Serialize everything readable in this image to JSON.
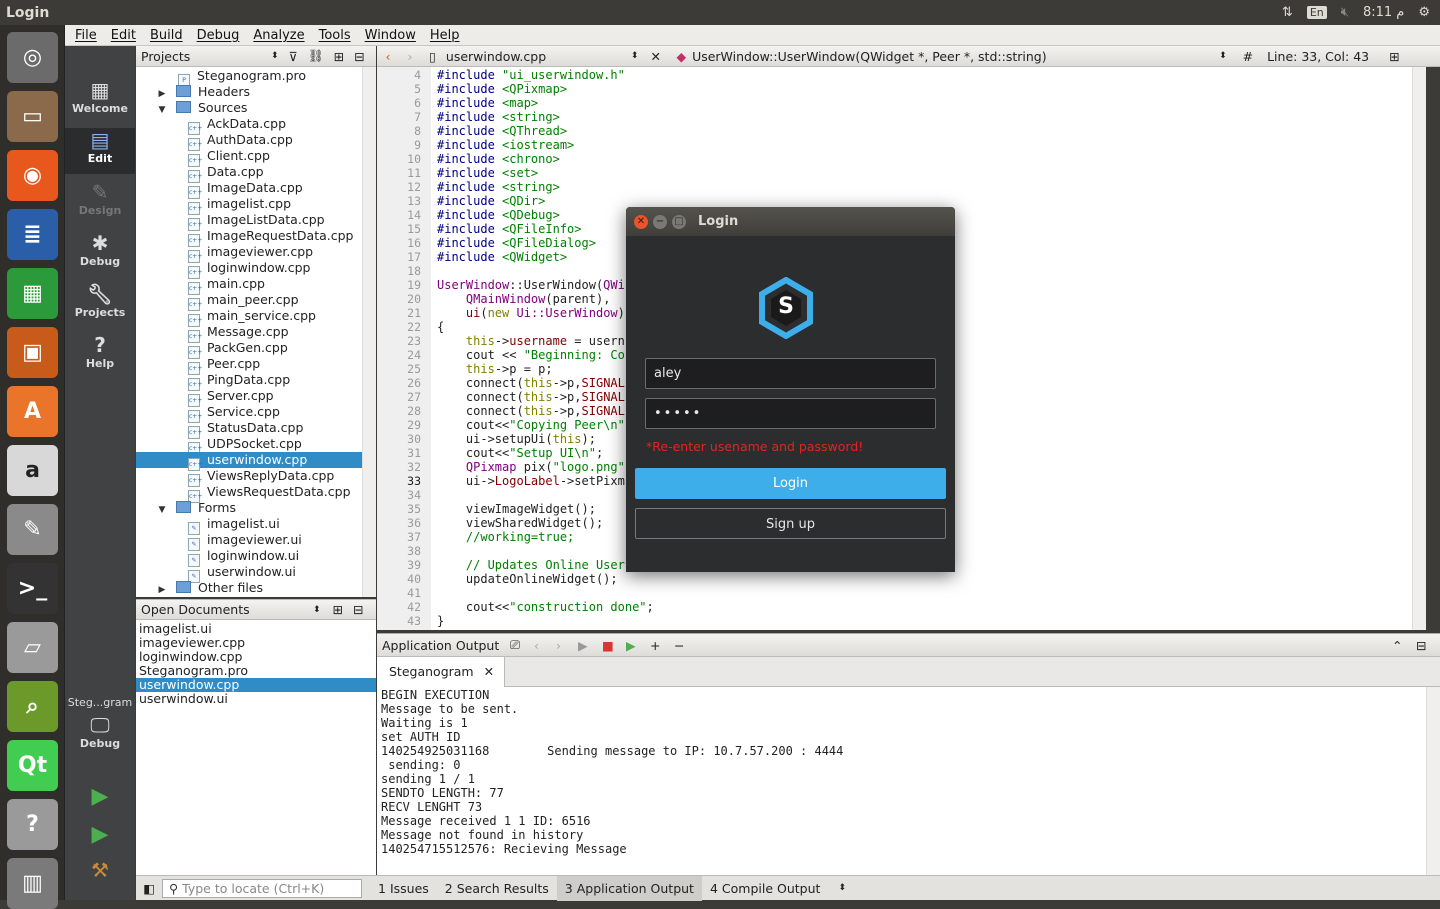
{
  "window_title": "Login",
  "system": {
    "lang": "En",
    "time": "8:11",
    "ampm": "م"
  },
  "menubar": [
    "File",
    "Edit",
    "Build",
    "Debug",
    "Analyze",
    "Tools",
    "Window",
    "Help"
  ],
  "modes": [
    {
      "label": "Welcome",
      "icon": "grid-icon"
    },
    {
      "label": "Edit",
      "icon": "edit-document-icon"
    },
    {
      "label": "Design",
      "icon": "pencil-icon"
    },
    {
      "label": "Debug",
      "icon": "bug-icon"
    },
    {
      "label": "Projects",
      "icon": "wrench-icon"
    },
    {
      "label": "Help",
      "icon": "help-icon"
    }
  ],
  "run_target": {
    "project": "Steg...gram",
    "mode": "Debug"
  },
  "projects": {
    "header": "Projects",
    "tree": [
      {
        "text": "Steganogram.pro",
        "indent": 1,
        "kind": "pro"
      },
      {
        "text": "Headers",
        "indent": 1,
        "kind": "folder",
        "arrow": "▶"
      },
      {
        "text": "Sources",
        "indent": 1,
        "kind": "folder",
        "arrow": "▼"
      },
      {
        "text": "AckData.cpp",
        "indent": 2,
        "kind": "file"
      },
      {
        "text": "AuthData.cpp",
        "indent": 2,
        "kind": "file"
      },
      {
        "text": "Client.cpp",
        "indent": 2,
        "kind": "file"
      },
      {
        "text": "Data.cpp",
        "indent": 2,
        "kind": "file"
      },
      {
        "text": "ImageData.cpp",
        "indent": 2,
        "kind": "file"
      },
      {
        "text": "imagelist.cpp",
        "indent": 2,
        "kind": "file"
      },
      {
        "text": "ImageListData.cpp",
        "indent": 2,
        "kind": "file"
      },
      {
        "text": "ImageRequestData.cpp",
        "indent": 2,
        "kind": "file"
      },
      {
        "text": "imageviewer.cpp",
        "indent": 2,
        "kind": "file"
      },
      {
        "text": "loginwindow.cpp",
        "indent": 2,
        "kind": "file"
      },
      {
        "text": "main.cpp",
        "indent": 2,
        "kind": "file"
      },
      {
        "text": "main_peer.cpp",
        "indent": 2,
        "kind": "file"
      },
      {
        "text": "main_service.cpp",
        "indent": 2,
        "kind": "file"
      },
      {
        "text": "Message.cpp",
        "indent": 2,
        "kind": "file"
      },
      {
        "text": "PackGen.cpp",
        "indent": 2,
        "kind": "file"
      },
      {
        "text": "Peer.cpp",
        "indent": 2,
        "kind": "file"
      },
      {
        "text": "PingData.cpp",
        "indent": 2,
        "kind": "file"
      },
      {
        "text": "Server.cpp",
        "indent": 2,
        "kind": "file"
      },
      {
        "text": "Service.cpp",
        "indent": 2,
        "kind": "file"
      },
      {
        "text": "StatusData.cpp",
        "indent": 2,
        "kind": "file"
      },
      {
        "text": "UDPSocket.cpp",
        "indent": 2,
        "kind": "file"
      },
      {
        "text": "userwindow.cpp",
        "indent": 2,
        "kind": "file",
        "selected": true
      },
      {
        "text": "ViewsReplyData.cpp",
        "indent": 2,
        "kind": "file"
      },
      {
        "text": "ViewsRequestData.cpp",
        "indent": 2,
        "kind": "file"
      },
      {
        "text": "Forms",
        "indent": 1,
        "kind": "folder",
        "arrow": "▼"
      },
      {
        "text": "imagelist.ui",
        "indent": 2,
        "kind": "ui"
      },
      {
        "text": "imageviewer.ui",
        "indent": 2,
        "kind": "ui"
      },
      {
        "text": "loginwindow.ui",
        "indent": 2,
        "kind": "ui"
      },
      {
        "text": "userwindow.ui",
        "indent": 2,
        "kind": "ui"
      },
      {
        "text": "Other files",
        "indent": 1,
        "kind": "folder",
        "arrow": "▶"
      }
    ]
  },
  "open_documents": {
    "header": "Open Documents",
    "items": [
      "imagelist.ui",
      "imageviewer.cpp",
      "loginwindow.cpp",
      "Steganogram.pro",
      "userwindow.cpp",
      "userwindow.ui"
    ],
    "selected_index": 4
  },
  "editor": {
    "file": "userwindow.cpp",
    "symbol": "UserWindow::UserWindow(QWidget *, Peer *, std::string)",
    "hash": "#",
    "position": "Line: 33, Col: 43",
    "first_line": 4,
    "current_line": 33,
    "lines": [
      [
        [
          "pp",
          "#include "
        ],
        [
          "str",
          "\"ui_userwindow.h\""
        ]
      ],
      [
        [
          "pp",
          "#include "
        ],
        [
          "str",
          "<QPixmap>"
        ]
      ],
      [
        [
          "pp",
          "#include "
        ],
        [
          "str",
          "<map>"
        ]
      ],
      [
        [
          "pp",
          "#include "
        ],
        [
          "str",
          "<string>"
        ]
      ],
      [
        [
          "pp",
          "#include "
        ],
        [
          "str",
          "<QThread>"
        ]
      ],
      [
        [
          "pp",
          "#include "
        ],
        [
          "str",
          "<iostream>"
        ]
      ],
      [
        [
          "pp",
          "#include "
        ],
        [
          "str",
          "<chrono>"
        ]
      ],
      [
        [
          "pp",
          "#include "
        ],
        [
          "str",
          "<set>"
        ]
      ],
      [
        [
          "pp",
          "#include "
        ],
        [
          "str",
          "<string>"
        ]
      ],
      [
        [
          "pp",
          "#include "
        ],
        [
          "str",
          "<QDir>"
        ]
      ],
      [
        [
          "pp",
          "#include "
        ],
        [
          "str",
          "<QDebug>"
        ]
      ],
      [
        [
          "pp",
          "#include "
        ],
        [
          "str",
          "<QFileInfo>"
        ]
      ],
      [
        [
          "pp",
          "#include "
        ],
        [
          "str",
          "<QFileDialog>"
        ]
      ],
      [
        [
          "pp",
          "#include "
        ],
        [
          "str",
          "<QWidget>"
        ]
      ],
      [],
      [
        [
          "pur",
          "UserWindow"
        ],
        [
          "",
          "::UserWindow("
        ],
        [
          "pur",
          "QWi"
        ]
      ],
      [
        [
          "",
          "    "
        ],
        [
          "pur",
          "QMainWindow"
        ],
        [
          "",
          "(parent),"
        ]
      ],
      [
        [
          "",
          "    "
        ],
        [
          "red",
          "ui"
        ],
        [
          "",
          "("
        ],
        [
          "kw",
          "new"
        ],
        [
          "",
          ""
        ],
        [
          "pur",
          " Ui::UserWindow"
        ],
        [
          "",
          ")"
        ]
      ],
      [
        [
          "",
          "{"
        ]
      ],
      [
        [
          "",
          "    "
        ],
        [
          "kw",
          "this"
        ],
        [
          "",
          "->"
        ],
        [
          "red",
          "username"
        ],
        [
          "",
          " = usern"
        ]
      ],
      [
        [
          "",
          "    cout << "
        ],
        [
          "str",
          "\"Beginning: Co"
        ]
      ],
      [
        [
          "",
          "    "
        ],
        [
          "kw",
          "this"
        ],
        [
          "",
          "->p = p;"
        ]
      ],
      [
        [
          "",
          "    connect("
        ],
        [
          "kw",
          "this"
        ],
        [
          "",
          "->p,"
        ],
        [
          "red",
          "SIGNAL"
        ]
      ],
      [
        [
          "",
          "    connect("
        ],
        [
          "kw",
          "this"
        ],
        [
          "",
          "->p,"
        ],
        [
          "red",
          "SIGNAL"
        ]
      ],
      [
        [
          "",
          "    connect("
        ],
        [
          "kw",
          "this"
        ],
        [
          "",
          "->p,"
        ],
        [
          "red",
          "SIGNAL"
        ]
      ],
      [
        [
          "",
          "    cout<<"
        ],
        [
          "str",
          "\"Copying Peer\\n\""
        ]
      ],
      [
        [
          "",
          "    ui->setupUi("
        ],
        [
          "kw",
          "this"
        ],
        [
          "",
          ");"
        ]
      ],
      [
        [
          "",
          "    cout<<"
        ],
        [
          "str",
          "\"Setup UI\\n\""
        ],
        [
          "",
          ";"
        ]
      ],
      [
        [
          "",
          "    "
        ],
        [
          "pur",
          "QPixmap"
        ],
        [
          "",
          " pix("
        ],
        [
          "str",
          "\"logo.png\""
        ]
      ],
      [
        [
          "",
          "    ui->"
        ],
        [
          "red",
          "LogoLabel"
        ],
        [
          "",
          "->setPixm"
        ]
      ],
      [],
      [
        [
          "",
          "    viewImageWidget();"
        ]
      ],
      [
        [
          "",
          "    viewSharedWidget();"
        ]
      ],
      [
        [
          "",
          "    "
        ],
        [
          "cmt",
          "//working=true;"
        ]
      ],
      [],
      [
        [
          "",
          "    "
        ],
        [
          "cmt",
          "// Updates Online User"
        ]
      ],
      [
        [
          "",
          "    updateOnlineWidget();"
        ]
      ],
      [],
      [
        [
          "",
          "    cout<<"
        ],
        [
          "str",
          "\"construction done\""
        ],
        [
          "",
          ";"
        ]
      ],
      [
        [
          "",
          "}"
        ]
      ]
    ]
  },
  "output": {
    "header": "Application Output",
    "tab": "Steganogram",
    "lines": [
      "BEGIN EXECUTION",
      "Message to be sent.",
      "Waiting is 1",
      "set AUTH ID",
      "140254925031168        Sending message to IP: 10.7.57.200 : 4444",
      " sending: 0",
      "sending 1 / 1",
      "SENDTO LENGTH: 77",
      "RECV LENGHT 73",
      "Message received 1 1 ID: 6516",
      "Message not found in history",
      "140254715512576: Recieving Message"
    ]
  },
  "statusbar": {
    "locate_placeholder": "Type to locate (Ctrl+K)",
    "tabs": [
      {
        "num": "1",
        "label": "Issues"
      },
      {
        "num": "2",
        "label": "Search Results"
      },
      {
        "num": "3",
        "label": "Application Output",
        "active": true
      },
      {
        "num": "4",
        "label": "Compile Output"
      }
    ]
  },
  "login_dialog": {
    "title": "Login",
    "logo_letter": "S",
    "username": "aley",
    "password_mask": "•••••",
    "error": "*Re-enter usename and password!",
    "login_label": "Login",
    "signup_label": "Sign up",
    "colors": {
      "accent": "#3daee9",
      "error": "#e0261b",
      "bg": "#2c2d2f"
    }
  },
  "launcher": [
    {
      "name": "ubuntu-dash-icon",
      "color": "#6b6b6b"
    },
    {
      "name": "files-icon",
      "color": "#8a6a4a"
    },
    {
      "name": "firefox-icon",
      "color": "#e8581c"
    },
    {
      "name": "writer-icon",
      "color": "#2a5ea8"
    },
    {
      "name": "calc-icon",
      "color": "#2b9a3a"
    },
    {
      "name": "impress-icon",
      "color": "#c85a1a"
    },
    {
      "name": "software-center-icon",
      "color": "#e9742a"
    },
    {
      "name": "amazon-icon",
      "color": "#d8d8d8"
    },
    {
      "name": "settings-icon",
      "color": "#8a8a8a"
    },
    {
      "name": "terminal-icon",
      "color": "#333333"
    },
    {
      "name": "scanner-icon",
      "color": "#9a9a9a"
    },
    {
      "name": "image-viewer-icon",
      "color": "#6b9a2a"
    },
    {
      "name": "qt-creator-icon",
      "color": "#41cd52"
    },
    {
      "name": "help-icon",
      "color": "#9a9a9a"
    },
    {
      "name": "trash-icon",
      "color": "#7a7a7a"
    }
  ]
}
